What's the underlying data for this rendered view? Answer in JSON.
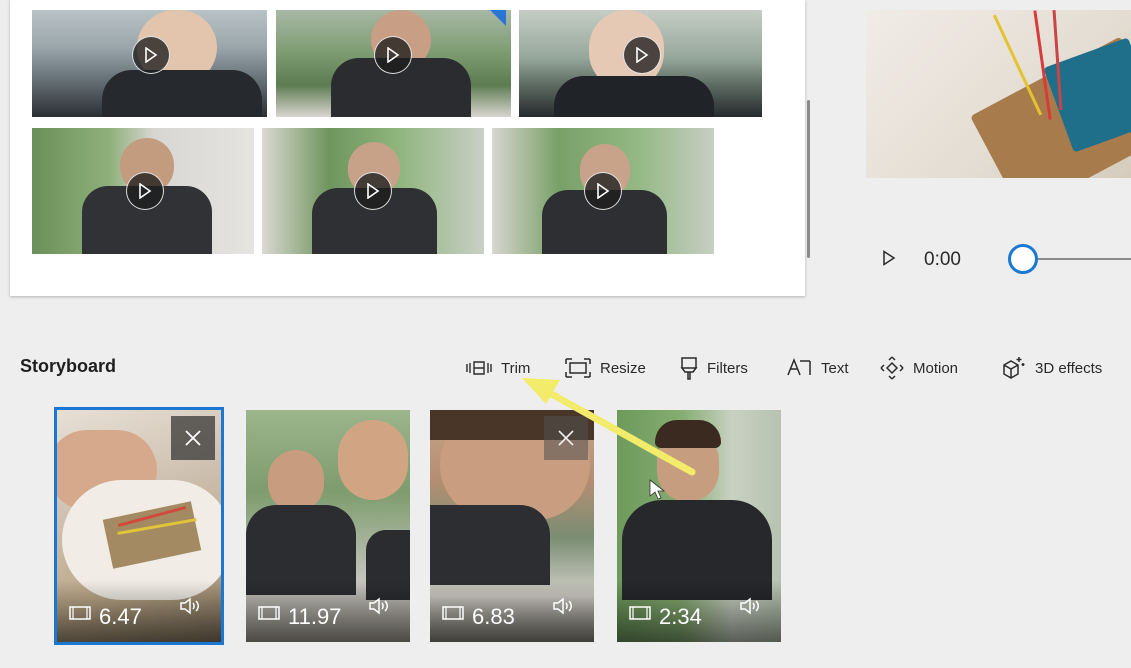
{
  "library": {
    "clips": [
      {
        "thumb": "library-clip-1"
      },
      {
        "thumb": "library-clip-2"
      },
      {
        "thumb": "library-clip-3"
      },
      {
        "thumb": "library-clip-4"
      },
      {
        "thumb": "library-clip-5"
      },
      {
        "thumb": "library-clip-6"
      }
    ]
  },
  "player": {
    "time": "0:00",
    "accent": "#1a78d2"
  },
  "storyboard": {
    "title": "Storyboard",
    "tools": [
      {
        "label": "Trim",
        "icon": "trim-icon"
      },
      {
        "label": "Resize",
        "icon": "resize-icon"
      },
      {
        "label": "Filters",
        "icon": "filters-icon"
      },
      {
        "label": "Text",
        "icon": "text-icon"
      },
      {
        "label": "Motion",
        "icon": "motion-icon"
      },
      {
        "label": "3D effects",
        "icon": "3d-effects-icon"
      }
    ],
    "cards": [
      {
        "duration": "6.47",
        "selected": true
      },
      {
        "duration": "11.97",
        "selected": false
      },
      {
        "duration": "6.83",
        "selected": false
      },
      {
        "duration": "2:34",
        "selected": false
      }
    ]
  },
  "annotation": {
    "arrow_color": "#f2ec6a"
  }
}
